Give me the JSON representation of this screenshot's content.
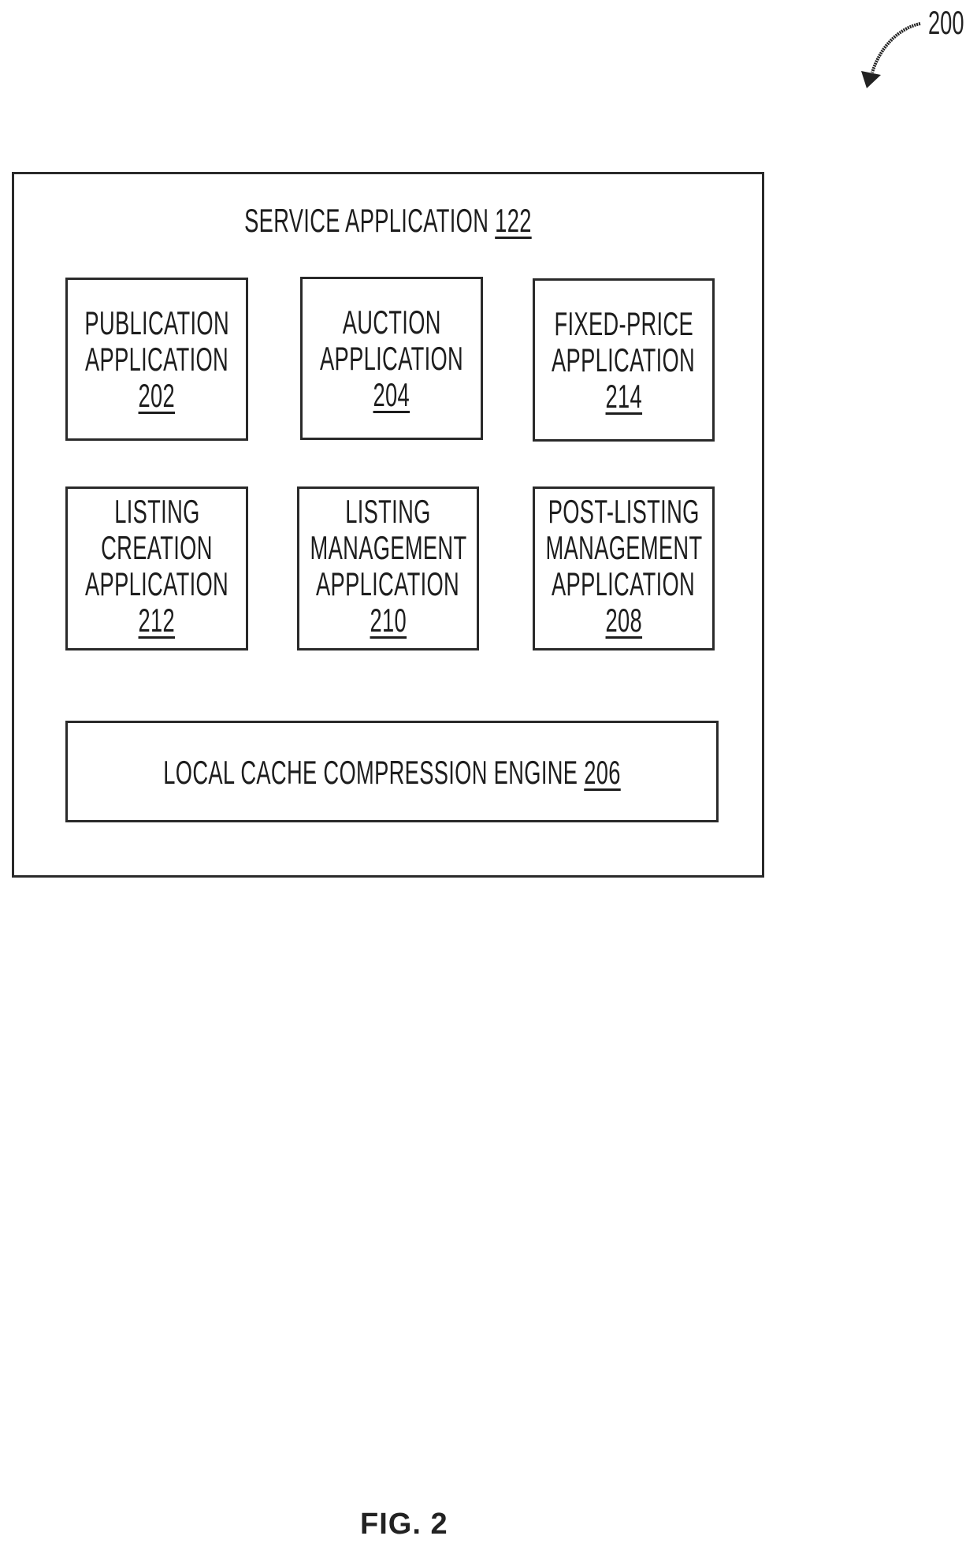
{
  "figure": {
    "label": "FIG. 2",
    "reference_number": "200"
  },
  "service_application": {
    "title": "SERVICE APPLICATION",
    "ref": "122",
    "components": [
      {
        "lines": [
          "PUBLICATION",
          "APPLICATION"
        ],
        "ref": "202"
      },
      {
        "lines": [
          "AUCTION",
          "APPLICATION"
        ],
        "ref": "204"
      },
      {
        "lines": [
          "FIXED-PRICE",
          "APPLICATION"
        ],
        "ref": "214"
      },
      {
        "lines": [
          "LISTING",
          "CREATION",
          "APPLICATION"
        ],
        "ref": "212"
      },
      {
        "lines": [
          "LISTING",
          "MANAGEMENT",
          "APPLICATION"
        ],
        "ref": "210"
      },
      {
        "lines": [
          "POST-LISTING",
          "MANAGEMENT",
          "APPLICATION"
        ],
        "ref": "208"
      }
    ],
    "engine": {
      "title": "LOCAL CACHE COMPRESSION ENGINE",
      "ref": "206"
    }
  }
}
